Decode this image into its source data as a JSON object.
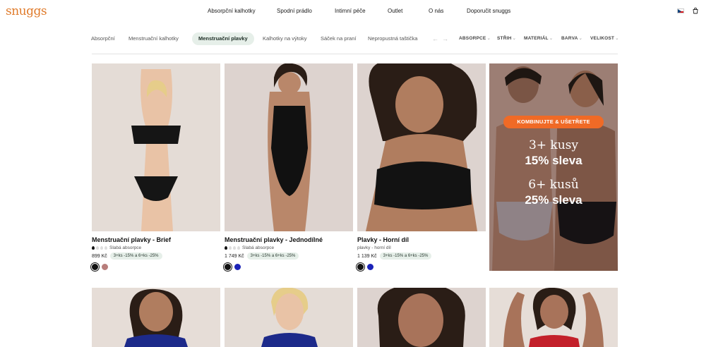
{
  "brand": {
    "logo": "snuggs",
    "accent": "#e07b2b"
  },
  "nav": {
    "items": [
      "Absorpční kalhotky",
      "Spodní prádlo",
      "Intimní péče",
      "Outlet",
      "O nás",
      "Doporučit snuggs"
    ],
    "locale_flag": "czech-flag",
    "cart_icon": "bag-icon"
  },
  "filters": {
    "categories": [
      "Absorpční",
      "Menstruační kalhotky",
      "Menstruační plavky",
      "Kalhotky na výtoky",
      "Sáček na praní",
      "Nepropustná taštička"
    ],
    "active_category": "Menstruační plavky",
    "prev_arrow": "←",
    "next_arrow": "→",
    "dropdowns": [
      "ABSORPCE",
      "STŘIH",
      "MATERIÁL",
      "BARVA",
      "VELIKOST"
    ]
  },
  "products": [
    {
      "title": "Menstruační plavky - Brief",
      "absorbency": "Slabá absorpce",
      "absorbency_level": 1,
      "price": "899 Kč",
      "promo": "3+ks -15% a 6+ks -25%",
      "swatches": [
        "#111111",
        "#b87d7b"
      ],
      "selected_swatch": 0
    },
    {
      "title": "Menstruační plavky - Jednodílné",
      "absorbency": "Slabá absorpce",
      "absorbency_level": 1,
      "price": "1 749 Kč",
      "promo": "3+ks -15% a 6+ks -25%",
      "swatches": [
        "#111111",
        "#1b23b8"
      ],
      "selected_swatch": 0
    },
    {
      "title": "Plavky - Horní díl",
      "absorbency": "plavky - horní díl",
      "absorbency_level": 0,
      "price": "1 139 Kč",
      "promo": "3+ks -15% a 6+ks -25%",
      "swatches": [
        "#111111",
        "#1b23b8"
      ],
      "selected_swatch": 0
    }
  ],
  "promo_tile": {
    "badge": "KOMBINUJTE & UŠETŘETE",
    "line1": "3+ kusy",
    "line2": "15% sleva",
    "line3": "6+ kusů",
    "line4": "25% sleva",
    "badge_color": "#f06a26"
  }
}
